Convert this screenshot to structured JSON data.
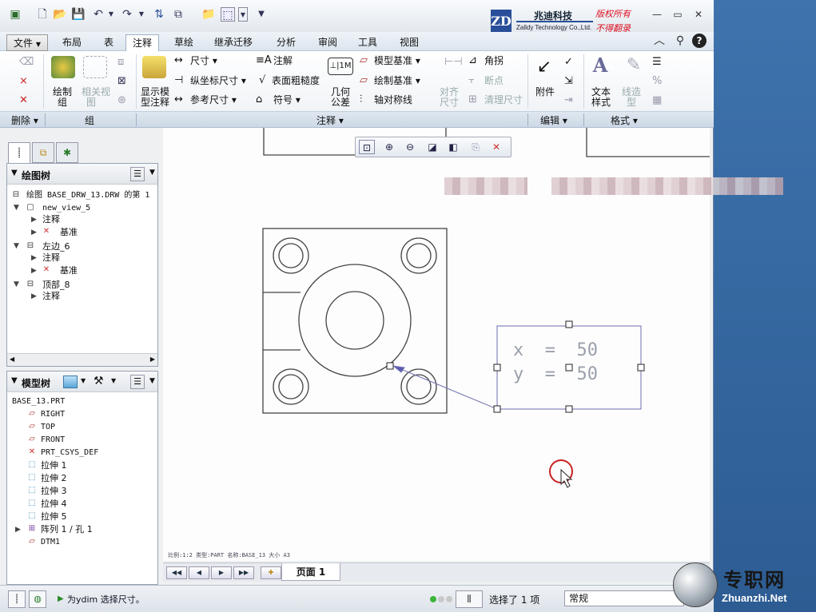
{
  "quick_access": [
    "new-icon",
    "open-icon",
    "save-icon",
    "undo-icon",
    "redo-icon",
    "regenerate-icon",
    "windows-icon",
    "folder-icon",
    "select-box-icon"
  ],
  "watermark_header": {
    "company_cn": "兆迪科技",
    "company_en": "Zalldy Technology Co.,Ltd.",
    "logo": "ZD",
    "copyright_1": "版权所有",
    "copyright_2": "不得翻录"
  },
  "tabs": [
    "文件",
    "布局",
    "表",
    "注释",
    "草绘",
    "继承迁移",
    "分析",
    "审阅",
    "工具",
    "视图"
  ],
  "active_tab": "注释",
  "ribbon": {
    "delete_group": "删除",
    "group_group": "组",
    "draw_group_btn": [
      "绘制",
      "组"
    ],
    "related_view_btn": [
      "相关视",
      "图"
    ],
    "show_model_btn": [
      "显示模",
      "型注释"
    ],
    "dimension": "尺寸",
    "ordinate_dim": "纵坐标尺寸",
    "reference_dim": "参考尺寸",
    "note": "注解",
    "surface_finish": "表面粗糙度",
    "symbol": "符号",
    "gtol": [
      "几何",
      "公差"
    ],
    "model_datum": "模型基准",
    "draw_datum": "绘制基准",
    "axis_symmetry": "轴对称线",
    "align_dim": [
      "对齐",
      "尺寸"
    ],
    "jog": "角拐",
    "breakpoint": "断点",
    "cleanup_dim": "清理尺寸",
    "attach": "附件",
    "text_style": [
      "文本",
      "样式"
    ],
    "line_style": [
      "线造",
      "型"
    ],
    "annotate_group": "注释",
    "edit_group": "编辑",
    "format_group": "格式"
  },
  "view_toolbar": [
    "zoom-fit-icon",
    "zoom-in-icon",
    "zoom-out-icon",
    "repaint-icon",
    "display-style-icon",
    "note-display-icon",
    "datum-display-icon"
  ],
  "drawing_tree": {
    "title": "绘图树",
    "root": "绘图 BASE_DRW_13.DRW 的第 1",
    "items": [
      {
        "label": "new_view_5",
        "level": 0
      },
      {
        "label": "注释",
        "level": 1
      },
      {
        "label": "基准",
        "level": 1
      },
      {
        "label": "左边_6",
        "level": 0
      },
      {
        "label": "注释",
        "level": 1
      },
      {
        "label": "基准",
        "level": 1
      },
      {
        "label": "顶部_8",
        "level": 0
      },
      {
        "label": "注释",
        "level": 1
      }
    ]
  },
  "model_tree": {
    "title": "模型树",
    "root": "BASE_13.PRT",
    "items": [
      "RIGHT",
      "TOP",
      "FRONT",
      "PRT_CSYS_DEF",
      "拉伸 1",
      "拉伸 2",
      "拉伸 3",
      "拉伸 4",
      "拉伸 5",
      "阵列 1 / 孔 1",
      "DTM1"
    ]
  },
  "drawing": {
    "ordinate_x": "x  =  50",
    "ordinate_y": "y  =  50",
    "info_line": "比例:1:2    类型:PART   名称:BASE_13   大小 A3"
  },
  "page_nav": {
    "page_label": "页面 1"
  },
  "status": {
    "message": "为ydim 选择尺寸。",
    "selection": "选择了 1 项",
    "filter": "常规"
  },
  "watermark": {
    "cn": "专职网",
    "en": "Zhuanzhi.Net"
  }
}
